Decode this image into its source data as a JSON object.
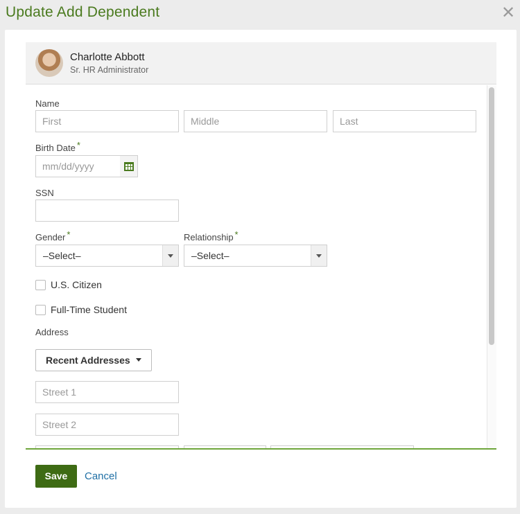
{
  "modal": {
    "title": "Update Add Dependent",
    "close_glyph": "✕"
  },
  "profile": {
    "name": "Charlotte Abbott",
    "role": "Sr. HR Administrator"
  },
  "form": {
    "name_label": "Name",
    "first_placeholder": "First",
    "middle_placeholder": "Middle",
    "last_placeholder": "Last",
    "birth_date_label": "Birth Date",
    "birth_date_placeholder": "mm/dd/yyyy",
    "required_marker": "*",
    "ssn_label": "SSN",
    "gender_label": "Gender",
    "gender_value": "–Select–",
    "relationship_label": "Relationship",
    "relationship_value": "–Select–",
    "us_citizen_label": "U.S. Citizen",
    "full_time_student_label": "Full-Time Student",
    "address_label": "Address",
    "recent_addresses_label": "Recent Addresses",
    "street1_placeholder": "Street 1",
    "street2_placeholder": "Street 2"
  },
  "footer": {
    "save_label": "Save",
    "cancel_label": "Cancel"
  },
  "colors": {
    "brand_green": "#4a7a1e",
    "save_green": "#3e6b14",
    "link_blue": "#1f6fa5",
    "accent_line": "#6da53a"
  }
}
